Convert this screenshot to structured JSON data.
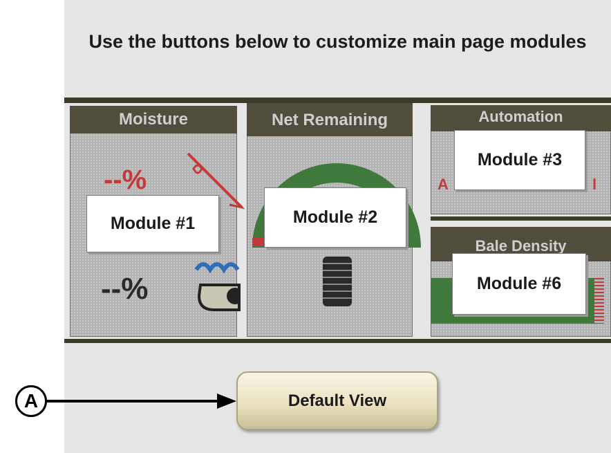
{
  "instruction": "Use the buttons below to customize main page modules",
  "columns": {
    "moisture": {
      "header": "Moisture",
      "value_top": "--%",
      "value_bottom": "--%"
    },
    "net_remaining": {
      "header": "Net Remaining"
    },
    "automation": {
      "header": "Automation",
      "partial_text_left": "A",
      "partial_text_right": "l"
    },
    "bale_density": {
      "header": "Bale Density"
    }
  },
  "modules": {
    "m1": "Module #1",
    "m2": "Module #2",
    "m3": "Module #3",
    "m6": "Module #6"
  },
  "default_button": {
    "label": "Default View"
  },
  "callout": {
    "label": "A"
  },
  "colors": {
    "header_bg": "#514d3d",
    "gauge_green": "#3f7a3c",
    "button_face": "#ebe3c0"
  },
  "icons": [
    "moisture-slash-icon",
    "water-wave-icon",
    "net-roll-icon"
  ]
}
